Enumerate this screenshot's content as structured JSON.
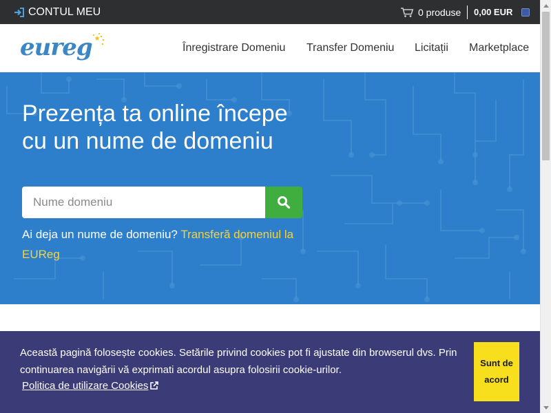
{
  "topbar": {
    "account_label": "CONTUL MEU",
    "account_icon": "sign-in-icon",
    "cart_icon": "cart-icon",
    "cart_label": "0 produse",
    "total": "0,00 EUR"
  },
  "header": {
    "logo_text": "eureg",
    "nav": [
      "Înregistrare Domeniu",
      "Transfer Domeniu",
      "Licitații",
      "Marketplace"
    ]
  },
  "hero": {
    "title": "Prezența ta online începe cu un nume de domeniu",
    "search_placeholder": "Nume domeniu",
    "search_icon": "search-icon",
    "transfer_text": "Ai deja un nume de domeniu?",
    "transfer_link": "Transferă domeniul la EUReg"
  },
  "cookie": {
    "text": "Această pagină folosește cookies. Setările privind cookies pot fi ajustate din browserul dvs. Prin continuarea navigării vă exprimati acordul asupra folosirii cookie-urilor.",
    "policy_link": "Politica de utilizare Cookies",
    "accept_label": "Sunt de acord"
  },
  "colors": {
    "topbar": "#2d2f31",
    "hero": "#2d7fcb",
    "search_button": "#3fae3f",
    "link_yellow": "#f6d33b",
    "cookie_bg": "#3b3b78",
    "accept_bg": "#f7df1e"
  }
}
